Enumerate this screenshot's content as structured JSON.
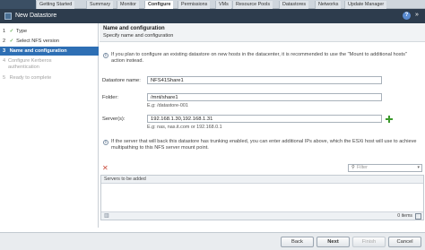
{
  "tabs": [
    "Getting Started",
    "Summary",
    "Monitor",
    "Configure",
    "Permissions",
    "VMs",
    "Resource Pools",
    "Datastores",
    "Networks",
    "Update Manager"
  ],
  "active_tab": "Configure",
  "dialog": {
    "title": "New Datastore",
    "help_icon": "?",
    "max_icon": "»"
  },
  "steps": [
    {
      "num": "1",
      "label": "Type",
      "state": "done"
    },
    {
      "num": "2",
      "label": "Select NFS version",
      "state": "done"
    },
    {
      "num": "3",
      "label": "Name and configuration",
      "state": "active"
    },
    {
      "num": "4",
      "label": "Configure Kerberos authentication",
      "line1": "Configure Kerberos",
      "line2": "authentication",
      "state": "disabled"
    },
    {
      "num": "5",
      "label": "Ready to complete",
      "state": "disabled"
    }
  ],
  "section": {
    "title": "Name and configuration",
    "subtitle": "Specify name and configuration"
  },
  "info1": "If you plan to configure an existing datastore on new hosts in the datacenter, it is recommended to use the \"Mount to additional hosts\" action instead.",
  "form": {
    "datastore_label": "Datastore name:",
    "datastore_value": "NFS41Share1",
    "folder_label": "Folder:",
    "folder_value": "/mnt/share1",
    "folder_hint": "E.g: /datastore-001",
    "servers_label": "Server(s):",
    "servers_value": "192.168.1.30,192.168.1.31",
    "servers_hint": "E.g: nas, nas.it.com or 192.168.0.1"
  },
  "info2": "If the server that will back this datastore has trunking enabled, you can enter additional IPs above, which the ESXi host will use to achieve multipathing to this NFS server mount point.",
  "table": {
    "filter_placeholder": "Filter",
    "column": "Servers to be added",
    "count": "0 items"
  },
  "buttons": {
    "back": "Back",
    "next": "Next",
    "finish": "Finish",
    "cancel": "Cancel"
  }
}
